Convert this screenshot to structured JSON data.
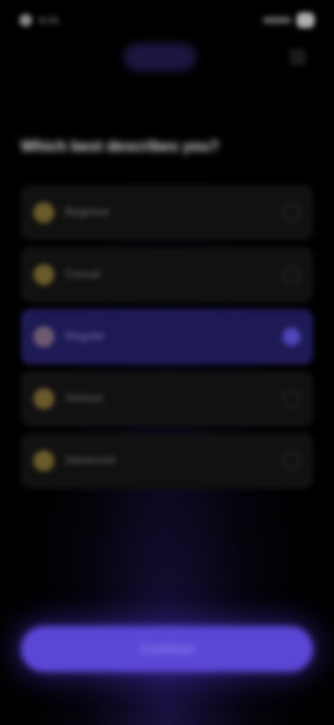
{
  "status_bar": {
    "time": "9:41"
  },
  "header": {
    "brand": ""
  },
  "question": {
    "title": "Which best describes you?"
  },
  "options": [
    {
      "label": "Beginner",
      "icon": "circle-icon",
      "selected": false
    },
    {
      "label": "Casual",
      "icon": "circle-icon",
      "selected": false
    },
    {
      "label": "Regular",
      "icon": "circle-icon",
      "selected": true
    },
    {
      "label": "Serious",
      "icon": "circle-icon",
      "selected": false
    },
    {
      "label": "Advanced",
      "icon": "circle-icon",
      "selected": false
    }
  ],
  "continue_button": {
    "label": "Continue"
  },
  "colors": {
    "accent": "#5b47d6",
    "selected_bg": "#1e1a55",
    "option_bg": "#111111",
    "background": "#000000"
  }
}
